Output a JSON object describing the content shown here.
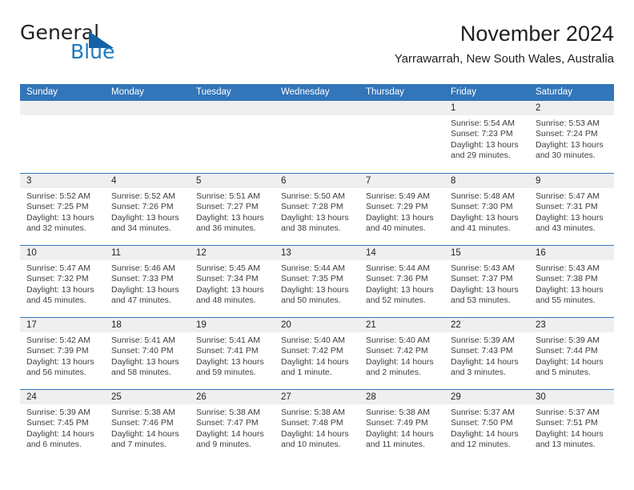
{
  "brand": {
    "name_part1": "General",
    "name_part2": "Blue",
    "flag_icon": "blue-flag-icon"
  },
  "header": {
    "title": "November 2024",
    "location": "Yarrawarrah, New South Wales, Australia"
  },
  "colors": {
    "header_blue": "#3275b9",
    "brand_blue": "#1c7ac0",
    "flag_blue": "#1461a5",
    "day_number_bg": "#efefef",
    "text": "#231f20"
  },
  "calendar": {
    "weekdays": [
      "Sunday",
      "Monday",
      "Tuesday",
      "Wednesday",
      "Thursday",
      "Friday",
      "Saturday"
    ],
    "weeks": [
      [
        {
          "num": "",
          "empty": true
        },
        {
          "num": "",
          "empty": true
        },
        {
          "num": "",
          "empty": true
        },
        {
          "num": "",
          "empty": true
        },
        {
          "num": "",
          "empty": true
        },
        {
          "num": "1",
          "sunrise": "Sunrise: 5:54 AM",
          "sunset": "Sunset: 7:23 PM",
          "daylight": "Daylight: 13 hours and 29 minutes."
        },
        {
          "num": "2",
          "sunrise": "Sunrise: 5:53 AM",
          "sunset": "Sunset: 7:24 PM",
          "daylight": "Daylight: 13 hours and 30 minutes."
        }
      ],
      [
        {
          "num": "3",
          "sunrise": "Sunrise: 5:52 AM",
          "sunset": "Sunset: 7:25 PM",
          "daylight": "Daylight: 13 hours and 32 minutes."
        },
        {
          "num": "4",
          "sunrise": "Sunrise: 5:52 AM",
          "sunset": "Sunset: 7:26 PM",
          "daylight": "Daylight: 13 hours and 34 minutes."
        },
        {
          "num": "5",
          "sunrise": "Sunrise: 5:51 AM",
          "sunset": "Sunset: 7:27 PM",
          "daylight": "Daylight: 13 hours and 36 minutes."
        },
        {
          "num": "6",
          "sunrise": "Sunrise: 5:50 AM",
          "sunset": "Sunset: 7:28 PM",
          "daylight": "Daylight: 13 hours and 38 minutes."
        },
        {
          "num": "7",
          "sunrise": "Sunrise: 5:49 AM",
          "sunset": "Sunset: 7:29 PM",
          "daylight": "Daylight: 13 hours and 40 minutes."
        },
        {
          "num": "8",
          "sunrise": "Sunrise: 5:48 AM",
          "sunset": "Sunset: 7:30 PM",
          "daylight": "Daylight: 13 hours and 41 minutes."
        },
        {
          "num": "9",
          "sunrise": "Sunrise: 5:47 AM",
          "sunset": "Sunset: 7:31 PM",
          "daylight": "Daylight: 13 hours and 43 minutes."
        }
      ],
      [
        {
          "num": "10",
          "sunrise": "Sunrise: 5:47 AM",
          "sunset": "Sunset: 7:32 PM",
          "daylight": "Daylight: 13 hours and 45 minutes."
        },
        {
          "num": "11",
          "sunrise": "Sunrise: 5:46 AM",
          "sunset": "Sunset: 7:33 PM",
          "daylight": "Daylight: 13 hours and 47 minutes."
        },
        {
          "num": "12",
          "sunrise": "Sunrise: 5:45 AM",
          "sunset": "Sunset: 7:34 PM",
          "daylight": "Daylight: 13 hours and 48 minutes."
        },
        {
          "num": "13",
          "sunrise": "Sunrise: 5:44 AM",
          "sunset": "Sunset: 7:35 PM",
          "daylight": "Daylight: 13 hours and 50 minutes."
        },
        {
          "num": "14",
          "sunrise": "Sunrise: 5:44 AM",
          "sunset": "Sunset: 7:36 PM",
          "daylight": "Daylight: 13 hours and 52 minutes."
        },
        {
          "num": "15",
          "sunrise": "Sunrise: 5:43 AM",
          "sunset": "Sunset: 7:37 PM",
          "daylight": "Daylight: 13 hours and 53 minutes."
        },
        {
          "num": "16",
          "sunrise": "Sunrise: 5:43 AM",
          "sunset": "Sunset: 7:38 PM",
          "daylight": "Daylight: 13 hours and 55 minutes."
        }
      ],
      [
        {
          "num": "17",
          "sunrise": "Sunrise: 5:42 AM",
          "sunset": "Sunset: 7:39 PM",
          "daylight": "Daylight: 13 hours and 56 minutes."
        },
        {
          "num": "18",
          "sunrise": "Sunrise: 5:41 AM",
          "sunset": "Sunset: 7:40 PM",
          "daylight": "Daylight: 13 hours and 58 minutes."
        },
        {
          "num": "19",
          "sunrise": "Sunrise: 5:41 AM",
          "sunset": "Sunset: 7:41 PM",
          "daylight": "Daylight: 13 hours and 59 minutes."
        },
        {
          "num": "20",
          "sunrise": "Sunrise: 5:40 AM",
          "sunset": "Sunset: 7:42 PM",
          "daylight": "Daylight: 14 hours and 1 minute."
        },
        {
          "num": "21",
          "sunrise": "Sunrise: 5:40 AM",
          "sunset": "Sunset: 7:42 PM",
          "daylight": "Daylight: 14 hours and 2 minutes."
        },
        {
          "num": "22",
          "sunrise": "Sunrise: 5:39 AM",
          "sunset": "Sunset: 7:43 PM",
          "daylight": "Daylight: 14 hours and 3 minutes."
        },
        {
          "num": "23",
          "sunrise": "Sunrise: 5:39 AM",
          "sunset": "Sunset: 7:44 PM",
          "daylight": "Daylight: 14 hours and 5 minutes."
        }
      ],
      [
        {
          "num": "24",
          "sunrise": "Sunrise: 5:39 AM",
          "sunset": "Sunset: 7:45 PM",
          "daylight": "Daylight: 14 hours and 6 minutes."
        },
        {
          "num": "25",
          "sunrise": "Sunrise: 5:38 AM",
          "sunset": "Sunset: 7:46 PM",
          "daylight": "Daylight: 14 hours and 7 minutes."
        },
        {
          "num": "26",
          "sunrise": "Sunrise: 5:38 AM",
          "sunset": "Sunset: 7:47 PM",
          "daylight": "Daylight: 14 hours and 9 minutes."
        },
        {
          "num": "27",
          "sunrise": "Sunrise: 5:38 AM",
          "sunset": "Sunset: 7:48 PM",
          "daylight": "Daylight: 14 hours and 10 minutes."
        },
        {
          "num": "28",
          "sunrise": "Sunrise: 5:38 AM",
          "sunset": "Sunset: 7:49 PM",
          "daylight": "Daylight: 14 hours and 11 minutes."
        },
        {
          "num": "29",
          "sunrise": "Sunrise: 5:37 AM",
          "sunset": "Sunset: 7:50 PM",
          "daylight": "Daylight: 14 hours and 12 minutes."
        },
        {
          "num": "30",
          "sunrise": "Sunrise: 5:37 AM",
          "sunset": "Sunset: 7:51 PM",
          "daylight": "Daylight: 14 hours and 13 minutes."
        }
      ]
    ]
  }
}
